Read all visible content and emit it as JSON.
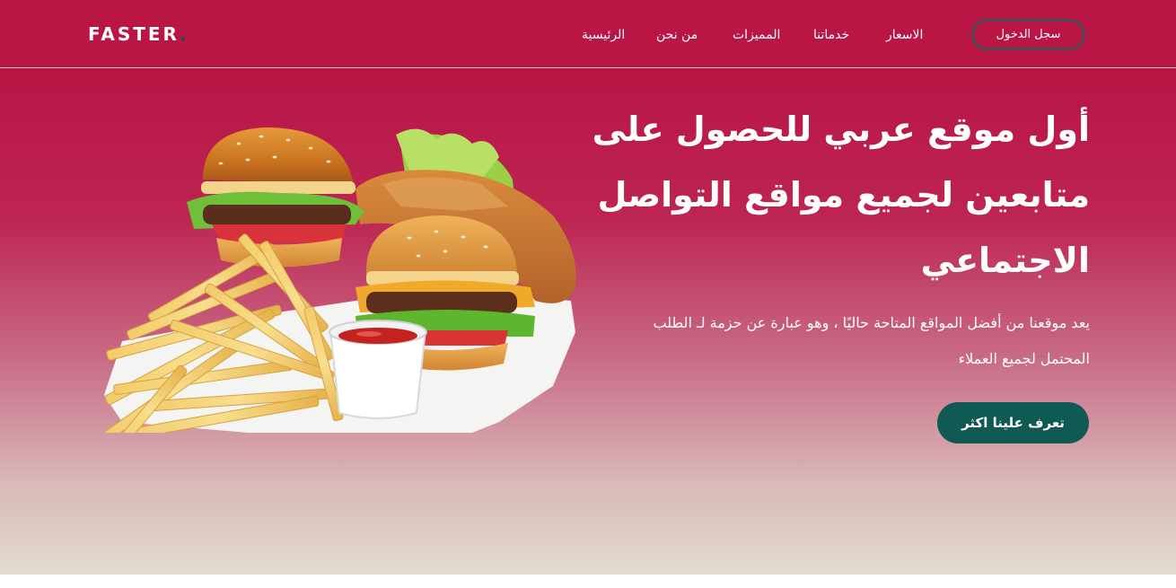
{
  "brand": {
    "name": "FASTER",
    "dot": "."
  },
  "nav": {
    "items": [
      {
        "id": "home",
        "label": "الرئيسية"
      },
      {
        "id": "about",
        "label": "من نحن"
      },
      {
        "id": "features",
        "label": "المميزات"
      },
      {
        "id": "services",
        "label": "خدماتنا"
      },
      {
        "id": "prices",
        "label": "الاسعار"
      }
    ],
    "login_label": "سجل الدخول"
  },
  "hero": {
    "title_lines": [
      "أول موقع عربي للحصول على",
      "متابعين لجميع مواقع التواصل",
      "الاجتماعي"
    ],
    "description_lines": [
      "يعد موقعنا من أفضل المواقع المتاحة حاليًا ، وهو عبارة عن حزمة لـ الطلب",
      "المحتمل لجميع العملاء"
    ],
    "cta_label": "تعرف علينا اكثر",
    "image": "burgers-and-fries"
  },
  "colors": {
    "brand": "#b91646",
    "accent": "#0f5a53",
    "gradient_end": "#e1dcd0"
  }
}
